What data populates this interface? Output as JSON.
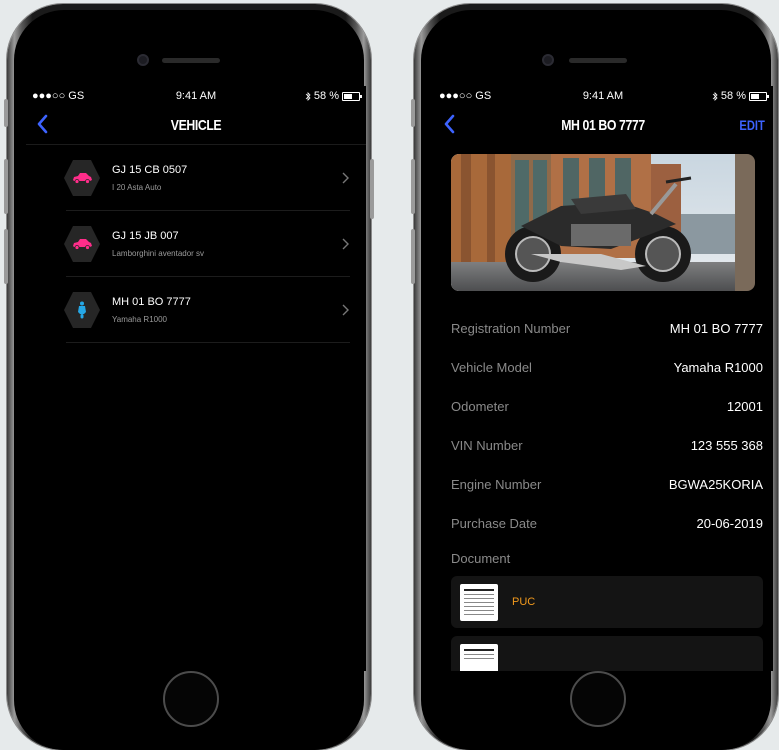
{
  "left_screen": {
    "status": {
      "carrier": "●●●○○ GS",
      "time": "9:41 AM",
      "battery": "58 %"
    },
    "title": "VEHICLE",
    "vehicles": [
      {
        "plate": "GJ 15 CB 0507",
        "model": "I 20 Asta Auto",
        "icon": "car-icon",
        "color": "#ff2d8a"
      },
      {
        "plate": "GJ 15 JB 007",
        "model": "Lamborghini aventador sv",
        "icon": "car-icon",
        "color": "#ff2d8a"
      },
      {
        "plate": "MH 01 BO 7777",
        "model": "Yamaha R1000",
        "icon": "scooter-icon",
        "color": "#25a7e6"
      }
    ]
  },
  "right_screen": {
    "status": {
      "carrier": "●●●○○ GS",
      "time": "9:41 AM",
      "battery": "58 %"
    },
    "title": "MH 01 BO 7777",
    "edit_label": "EDIT",
    "details": [
      {
        "label": "Registration Number",
        "value": "MH 01 BO 7777"
      },
      {
        "label": "Vehicle Model",
        "value": "Yamaha R1000"
      },
      {
        "label": "Odometer",
        "value": "12001"
      },
      {
        "label": "VIN Number",
        "value": "123 555 368"
      },
      {
        "label": "Engine Number",
        "value": "BGWA25KORIA"
      },
      {
        "label": "Purchase Date",
        "value": "20-06-2019"
      }
    ],
    "document_title": "Document",
    "documents": [
      {
        "name": "PUC"
      },
      {
        "name": ""
      }
    ]
  },
  "colors": {
    "accent": "#3d63ff",
    "document": "#f29a1d",
    "car": "#ff2d8a",
    "bike": "#25a7e6"
  }
}
